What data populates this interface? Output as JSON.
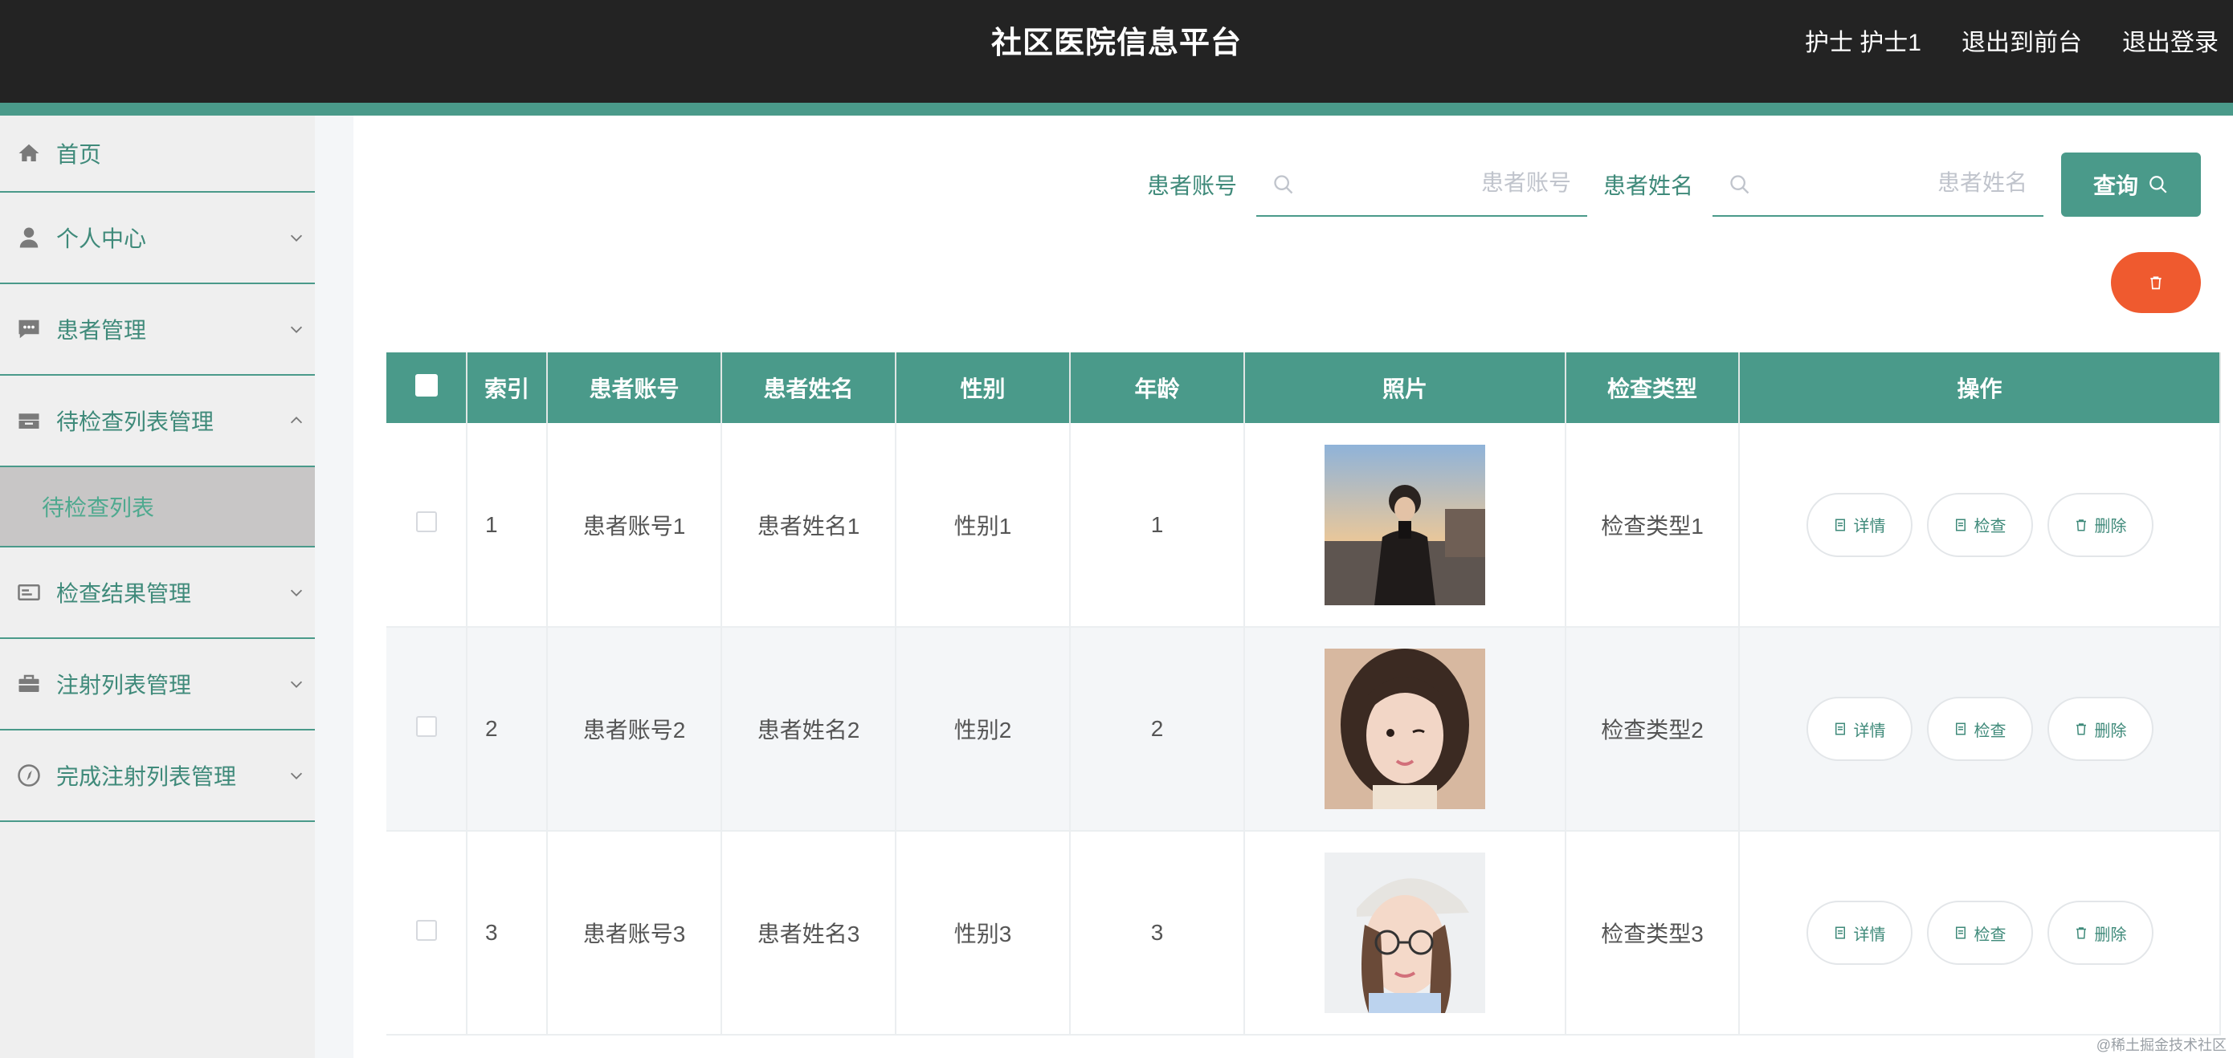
{
  "header": {
    "title": "社区医院信息平台",
    "user": "护士 护士1",
    "to_front": "退出到前台",
    "logout": "退出登录"
  },
  "sidebar": {
    "items": [
      {
        "label": "首页",
        "icon": "home-icon"
      },
      {
        "label": "个人中心",
        "icon": "person-icon"
      },
      {
        "label": "患者管理",
        "icon": "chat-icon"
      },
      {
        "label": "待检查列表管理",
        "icon": "tray-icon"
      },
      {
        "label": "检查结果管理",
        "icon": "card-icon"
      },
      {
        "label": "注射列表管理",
        "icon": "briefcase-icon"
      },
      {
        "label": "完成注射列表管理",
        "icon": "compass-icon"
      }
    ],
    "submenu": {
      "label": "待检查列表"
    }
  },
  "search": {
    "account_label": "患者账号",
    "account_placeholder": "患者账号",
    "name_label": "患者姓名",
    "name_placeholder": "患者姓名",
    "query_label": "查询"
  },
  "table": {
    "columns": [
      "索引",
      "患者账号",
      "患者姓名",
      "性别",
      "年龄",
      "照片",
      "检查类型",
      "操作"
    ],
    "rows": [
      {
        "index": "1",
        "account": "患者账号1",
        "name": "患者姓名1",
        "gender": "性别1",
        "age": "1",
        "type": "检查类型1"
      },
      {
        "index": "2",
        "account": "患者账号2",
        "name": "患者姓名2",
        "gender": "性别2",
        "age": "2",
        "type": "检查类型2"
      },
      {
        "index": "3",
        "account": "患者账号3",
        "name": "患者姓名3",
        "gender": "性别3",
        "age": "3",
        "type": "检查类型3"
      }
    ],
    "actions": {
      "detail": "详情",
      "check": "检查",
      "delete": "删除"
    }
  },
  "watermark": "@稀土掘金技术社区",
  "colors": {
    "accent": "#4a9a8a",
    "header_bg": "#232323",
    "danger": "#ef5a2f"
  }
}
